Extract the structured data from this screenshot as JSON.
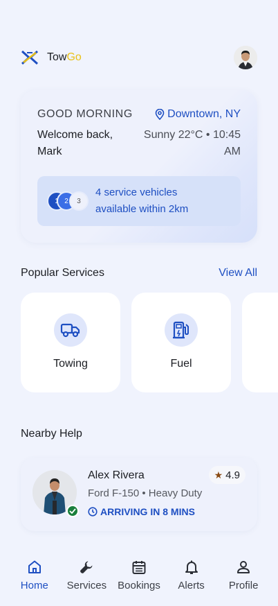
{
  "header": {
    "brand_tow": "Tow",
    "brand_go": "Go"
  },
  "greeting_card": {
    "greeting": "GOOD MORNING",
    "location": "Downtown, NY",
    "welcome": "Welcome back, Mark",
    "weather": "Sunny 22°C • 10:45 AM",
    "chips": [
      "1",
      "2",
      "3"
    ],
    "availability": "4 service vehicles available within 2km"
  },
  "services": {
    "title": "Popular Services",
    "view_all": "View All",
    "items": [
      {
        "label": "Towing",
        "icon": "truck-icon"
      },
      {
        "label": "Fuel",
        "icon": "ev-fuel-icon"
      }
    ]
  },
  "nearby": {
    "title": "Nearby Help",
    "name": "Alex Rivera",
    "vehicle": "Ford F-150 • Heavy Duty",
    "status": "ARRIVING IN 8 MINS",
    "rating": "4.9"
  },
  "nav": {
    "items": [
      {
        "label": "Home",
        "icon": "home-icon",
        "active": true
      },
      {
        "label": "Services",
        "icon": "wrench-icon"
      },
      {
        "label": "Bookings",
        "icon": "calendar-icon"
      },
      {
        "label": "Alerts",
        "icon": "bell-icon"
      },
      {
        "label": "Profile",
        "icon": "person-icon"
      }
    ]
  },
  "colors": {
    "accent": "#1e4fc2",
    "background": "#f0f3fd",
    "brand_yellow": "#e9c117",
    "verified": "#1a7f3c"
  }
}
